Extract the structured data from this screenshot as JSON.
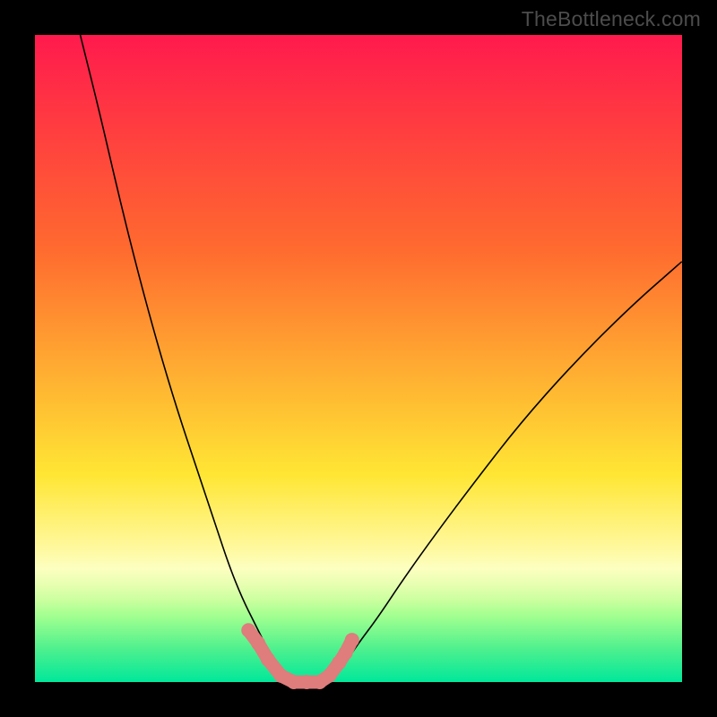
{
  "watermark": "TheBottleneck.com",
  "colors": {
    "frame_bg": "#000000",
    "curve": "#000000",
    "marker": "#df7c7c",
    "gradient_stops": [
      "#ff1a4d",
      "#ff6a2f",
      "#ffe634",
      "#fff89b",
      "#fcffc0",
      "#e6ffb0",
      "#c8ff9e",
      "#9eff8f",
      "#4cf08e",
      "#00e89a"
    ]
  },
  "chart_data": {
    "type": "line",
    "title": "",
    "xlabel": "",
    "ylabel": "",
    "xlim": [
      0,
      100
    ],
    "ylim": [
      0,
      100
    ],
    "grid": false,
    "legend": false,
    "series": [
      {
        "name": "left-branch",
        "x": [
          7,
          10,
          13,
          16,
          19,
          22,
          25,
          28,
          30,
          32,
          34,
          36,
          37,
          38,
          39
        ],
        "y": [
          100,
          88,
          75,
          63,
          52,
          42,
          33,
          24,
          18,
          13,
          9,
          5,
          3,
          1,
          0
        ]
      },
      {
        "name": "right-branch",
        "x": [
          45,
          46,
          48,
          50,
          53,
          57,
          62,
          68,
          75,
          83,
          92,
          100
        ],
        "y": [
          0,
          1,
          3,
          6,
          10,
          16,
          23,
          31,
          40,
          49,
          58,
          65
        ]
      }
    ],
    "markers": {
      "name": "bottom-marker-band",
      "points": [
        {
          "x": 33,
          "y": 8
        },
        {
          "x": 34.5,
          "y": 6
        },
        {
          "x": 36,
          "y": 3.5
        },
        {
          "x": 38,
          "y": 1
        },
        {
          "x": 40,
          "y": 0
        },
        {
          "x": 42,
          "y": 0
        },
        {
          "x": 44,
          "y": 0
        },
        {
          "x": 45.5,
          "y": 1
        },
        {
          "x": 47,
          "y": 3
        },
        {
          "x": 48,
          "y": 4.5
        },
        {
          "x": 49,
          "y": 6.5
        }
      ],
      "radius": 8
    }
  }
}
